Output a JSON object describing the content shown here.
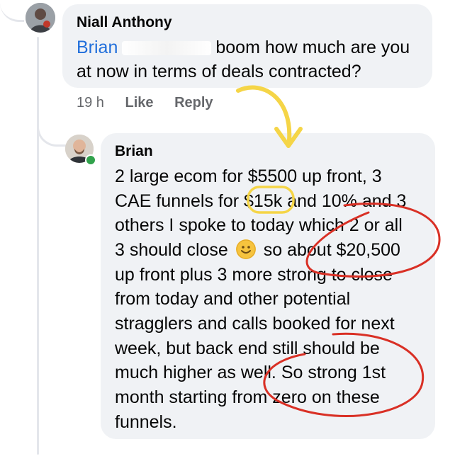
{
  "comment": {
    "author": "Niall Anthony",
    "mention": "Brian",
    "text_line1": "boom how much are you",
    "text_line2": "at now in terms of deals contracted?",
    "timestamp": "19 h",
    "like_label": "Like",
    "reply_label": "Reply"
  },
  "reply": {
    "author": "Brian",
    "lines": [
      "2 large ecom for $5500 up front, 3",
      "CAE funnels for $15k and 10% and 3",
      "others I spoke to today which 2 or all",
      "3 should close",
      "so about $20,500",
      "up front plus 3 more strong to close",
      "from today and other potential",
      "stragglers and calls booked for next",
      "week, but back end still should be",
      "much higher as well. So strong 1st",
      "month starting from zero on these",
      "funnels."
    ]
  },
  "annotations": {
    "arrow_color": "#f5d547",
    "circle_color": "#d93025"
  }
}
